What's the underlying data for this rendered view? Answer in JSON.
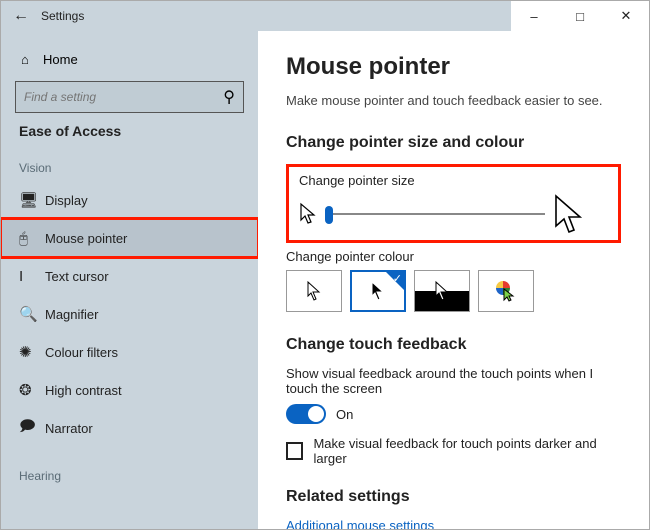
{
  "window": {
    "title": "Settings"
  },
  "sidebar": {
    "home_label": "Home",
    "search_placeholder": "Find a setting",
    "category": "Ease of Access",
    "group_vision": "Vision",
    "group_hearing": "Hearing",
    "items": [
      {
        "label": "Display"
      },
      {
        "label": "Mouse pointer"
      },
      {
        "label": "Text cursor"
      },
      {
        "label": "Magnifier"
      },
      {
        "label": "Colour filters"
      },
      {
        "label": "High contrast"
      },
      {
        "label": "Narrator"
      }
    ]
  },
  "main": {
    "heading": "Mouse pointer",
    "subheading": "Make mouse pointer and touch feedback easier to see.",
    "section_size_colour": "Change pointer size and colour",
    "pointer_size_label": "Change pointer size",
    "pointer_colour_label": "Change pointer colour",
    "section_touch": "Change touch feedback",
    "touch_desc": "Show visual feedback around the touch points when I touch the screen",
    "toggle_on": "On",
    "touch_darker": "Make visual feedback for touch points darker and larger",
    "section_related": "Related settings",
    "related_link": "Additional mouse settings"
  }
}
